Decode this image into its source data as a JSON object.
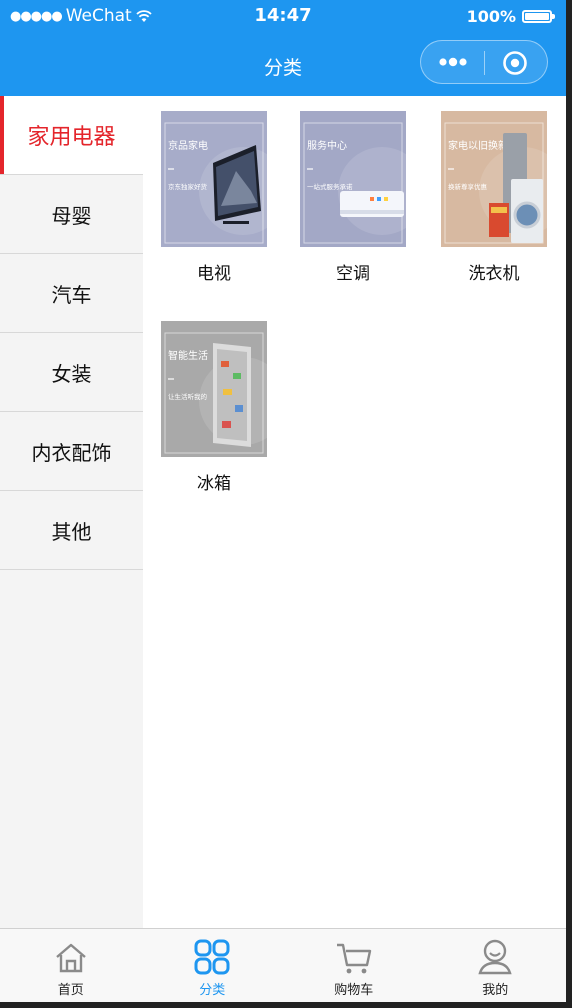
{
  "status_bar": {
    "signal": "●●●●●",
    "carrier": "WeChat",
    "time": "14:47",
    "battery": "100%"
  },
  "navbar": {
    "title": "分类"
  },
  "sidebar": {
    "items": [
      {
        "label": "家用电器",
        "active": true
      },
      {
        "label": "母婴"
      },
      {
        "label": "汽车"
      },
      {
        "label": "女装"
      },
      {
        "label": "内衣配饰"
      },
      {
        "label": "其他"
      }
    ]
  },
  "products": [
    {
      "label": "电视",
      "banner_title": "京品家电",
      "banner_sub": "京东独家好货",
      "bg": "#A7ACC9"
    },
    {
      "label": "空调",
      "banner_title": "服务中心",
      "banner_sub": "一站式服务承诺",
      "bg": "#A3A8C6"
    },
    {
      "label": "洗衣机",
      "banner_title": "家电以旧换新",
      "banner_sub": "换新尊享优惠",
      "bg": "#D7B9A1"
    },
    {
      "label": "冰箱",
      "banner_title": "智能生活",
      "banner_sub": "让生活听我的",
      "bg": "#A9A9A9"
    }
  ],
  "tabbar": {
    "items": [
      {
        "label": "首页",
        "icon": "home-icon"
      },
      {
        "label": "分类",
        "icon": "category-icon",
        "active": true
      },
      {
        "label": "购物车",
        "icon": "cart-icon"
      },
      {
        "label": "我的",
        "icon": "profile-icon"
      }
    ]
  },
  "colors": {
    "accent": "#1E96F0",
    "active_text": "#E4252B"
  }
}
